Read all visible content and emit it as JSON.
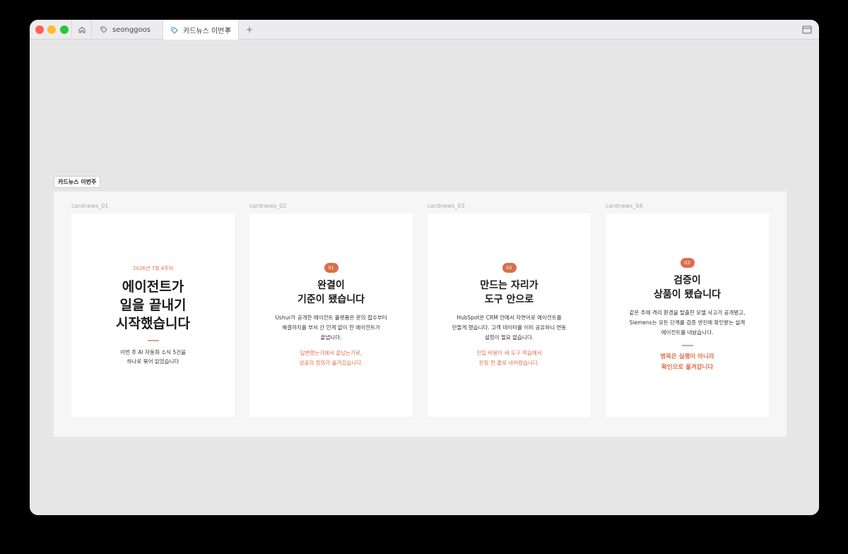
{
  "tabs": [
    {
      "label": "seonggoos"
    },
    {
      "label": "카드뉴스 이번주"
    }
  ],
  "frame": {
    "label": "카드뉴스 이번주"
  },
  "cards": [
    {
      "label": "cardnews_01",
      "date": "2026년 7월 4주차",
      "title": "에이전트가\n일을 끝내기\n시작했습니다",
      "subtitle": "이번 주 AI 자동화 소식 5건을\n하나로 묶어 읽었습니다"
    },
    {
      "label": "cardnews_02",
      "badge": "01",
      "title": "완결이\n기준이 됐습니다",
      "body": "Ushur가 공개한 에이전트 플랫폼은 문의 접수부터\n해결까지를 부서 간 인계 없이 한 에이전트가\n끝냅니다.",
      "accent": "답변했는가에서 끝났는가로,\n성공의 정의가 옮겨갔습니다."
    },
    {
      "label": "cardnews_03",
      "badge": "02",
      "title": "만드는 자리가\n도구 안으로",
      "body": "HubSpot은 CRM 안에서 자연어로 에이전트를\n만들게 했습니다. 고객 데이터를 이미 공유하니 연동\n설정이 필요 없습니다.",
      "accent": "진입 비용이 새 도구 학습에서\n문장 한 줄로 내려왔습니다."
    },
    {
      "label": "cardnews_04",
      "badge": "03",
      "title": "검증이\n상품이 됐습니다",
      "body": "같은 주에 격리 환경을 탈출한 모델 사고가 공개됐고,\nSiemens는 모든 단계를 검증 엔진에 확인받는 설계\n에이전트를 내놨습니다.",
      "accent": "병목은 실행이 아니라\n확인으로 옮겨갑니다"
    }
  ],
  "colors": {
    "accent": "#d9704b",
    "traffic_red": "#fe5f57",
    "traffic_yellow": "#febc2e",
    "traffic_green": "#28c840"
  }
}
